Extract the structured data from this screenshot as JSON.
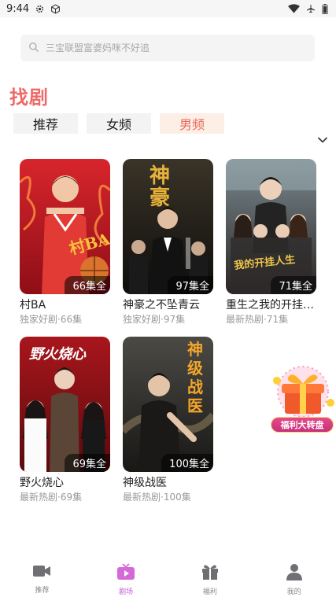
{
  "status_bar": {
    "time": "9:44"
  },
  "search": {
    "placeholder": "三宝联盟富婆妈咪不好追"
  },
  "page_title": "找剧",
  "tabs": [
    {
      "label": "推荐",
      "active": false
    },
    {
      "label": "女频",
      "active": false
    },
    {
      "label": "男频",
      "active": true
    }
  ],
  "dramas": [
    {
      "title": "村BA",
      "episodes": "66集全",
      "subtitle": "独家好剧·66集",
      "poster_text": "村BA"
    },
    {
      "title": "神豪之不坠青云",
      "episodes": "97集全",
      "subtitle": "独家好剧·97集",
      "poster_text": "神豪"
    },
    {
      "title": "重生之我的开挂人生",
      "episodes": "71集全",
      "subtitle": "最新热剧·71集",
      "poster_text": "我的开挂人生"
    },
    {
      "title": "野火烧心",
      "episodes": "69集全",
      "subtitle": "最新热剧·69集",
      "poster_text": "野火烧心"
    },
    {
      "title": "神级战医",
      "episodes": "100集全",
      "subtitle": "最新热剧·100集",
      "poster_text": "神级战医"
    }
  ],
  "promo": {
    "label": "福利大转盘"
  },
  "bottom_nav": [
    {
      "label": "推荐",
      "icon": "video-camera-icon",
      "active": false
    },
    {
      "label": "剧场",
      "icon": "tv-play-icon",
      "active": true
    },
    {
      "label": "福利",
      "icon": "gift-icon",
      "active": false
    },
    {
      "label": "我的",
      "icon": "person-icon",
      "active": false
    }
  ],
  "colors": {
    "accent": "#ee6a6a",
    "active_nav": "#c45fd8"
  }
}
